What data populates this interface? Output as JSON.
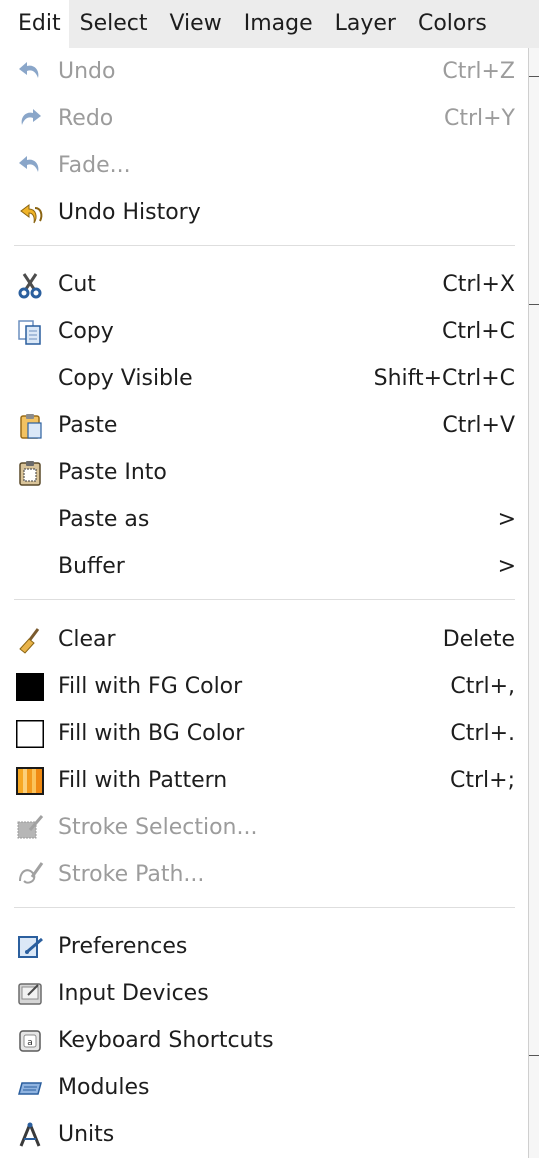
{
  "menubar": {
    "items": [
      {
        "label": "Edit"
      },
      {
        "label": "Select"
      },
      {
        "label": "View"
      },
      {
        "label": "Image"
      },
      {
        "label": "Layer"
      },
      {
        "label": "Colors"
      }
    ]
  },
  "menu": {
    "undo": {
      "label": "Undo",
      "accel": "Ctrl+Z",
      "icon": "undo-icon",
      "enabled": false
    },
    "redo": {
      "label": "Redo",
      "accel": "Ctrl+Y",
      "icon": "redo-icon",
      "enabled": false
    },
    "fade": {
      "label": "Fade...",
      "icon": "fade-icon",
      "enabled": false
    },
    "undo_history": {
      "label": "Undo History",
      "icon": "undo-history-icon"
    },
    "cut": {
      "label": "Cut",
      "accel": "Ctrl+X",
      "icon": "scissors-icon"
    },
    "copy": {
      "label": "Copy",
      "accel": "Ctrl+C",
      "icon": "copy-icon"
    },
    "copy_visible": {
      "label": "Copy Visible",
      "accel": "Shift+Ctrl+C"
    },
    "paste": {
      "label": "Paste",
      "accel": "Ctrl+V",
      "icon": "paste-icon"
    },
    "paste_into": {
      "label": "Paste Into",
      "icon": "paste-into-icon"
    },
    "paste_as": {
      "label": "Paste as",
      "arrow": ">"
    },
    "buffer": {
      "label": "Buffer",
      "arrow": ">"
    },
    "clear": {
      "label": "Clear",
      "accel": "Delete",
      "icon": "broom-icon"
    },
    "fill_fg": {
      "label": "Fill with FG Color",
      "accel": "Ctrl+,",
      "icon": "fg-color-swatch-icon",
      "color": "#000000"
    },
    "fill_bg": {
      "label": "Fill with BG Color",
      "accel": "Ctrl+.",
      "icon": "bg-color-swatch-icon",
      "color": "#ffffff"
    },
    "fill_pattern": {
      "label": "Fill with Pattern",
      "accel": "Ctrl+;",
      "icon": "pattern-swatch-icon",
      "color": "#f39a1c"
    },
    "stroke_selection": {
      "label": "Stroke Selection...",
      "icon": "stroke-selection-icon",
      "enabled": false
    },
    "stroke_path": {
      "label": "Stroke Path...",
      "icon": "stroke-path-icon",
      "enabled": false
    },
    "preferences": {
      "label": "Preferences",
      "icon": "preferences-icon"
    },
    "input_devices": {
      "label": "Input Devices",
      "icon": "input-devices-icon"
    },
    "keyboard_shortcuts": {
      "label": "Keyboard Shortcuts",
      "icon": "keyboard-icon"
    },
    "modules": {
      "label": "Modules",
      "icon": "modules-icon"
    },
    "units": {
      "label": "Units",
      "icon": "units-icon"
    }
  },
  "colors": {
    "menubar_bg": "#ececec",
    "menu_bg": "#ffffff",
    "text": "#1d1d1d",
    "disabled_text": "#9c9c9c",
    "icon_blue": "#2b5f9e"
  }
}
